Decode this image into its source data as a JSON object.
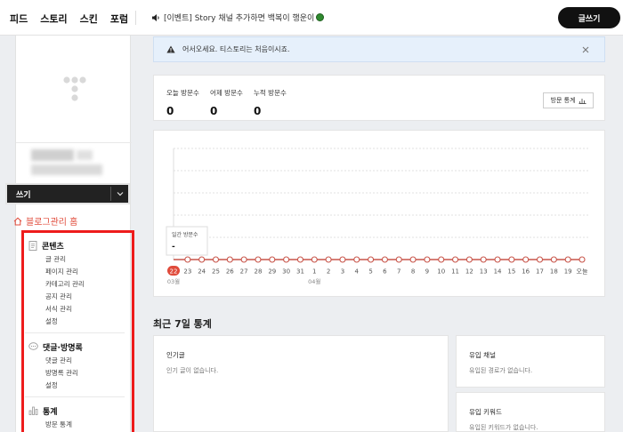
{
  "nav": [
    "피드",
    "스토리",
    "스킨",
    "포럼"
  ],
  "notice": {
    "text": "[이벤트] Story 채널 추가하면 백복이 행운이",
    "icon": "speaker-icon"
  },
  "write_button": "글쓰기",
  "sidebar": {
    "write_bar_label": "쓰기",
    "home_link": "블로그관리 홈",
    "sections": [
      {
        "title": "콘텐츠",
        "icon": "document-icon",
        "items": [
          "글 관리",
          "페이지 관리",
          "카테고리 관리",
          "공지 관리",
          "서식 관리",
          "설정"
        ]
      },
      {
        "title": "댓글·방명록",
        "icon": "speech-bubble-icon",
        "items": [
          "댓글 관리",
          "방명록 관리",
          "설정"
        ]
      },
      {
        "title": "통계",
        "icon": "bar-chart-icon",
        "items": [
          "방문 통계"
        ]
      }
    ]
  },
  "alert": {
    "text": "어서오세요. 티스토리는 처음이시죠."
  },
  "stats": {
    "today_label": "오늘 방문수",
    "today_value": "0",
    "yesterday_label": "어제 방문수",
    "yesterday_value": "0",
    "total_label": "누적 방문수",
    "total_value": "0",
    "visit_stats_button": "방문 통계"
  },
  "chart_data": {
    "type": "line",
    "x": [
      "22",
      "23",
      "24",
      "25",
      "26",
      "27",
      "28",
      "29",
      "30",
      "31",
      "1",
      "2",
      "3",
      "4",
      "5",
      "6",
      "7",
      "8",
      "9",
      "10",
      "11",
      "12",
      "13",
      "14",
      "15",
      "16",
      "17",
      "18",
      "19",
      "오늘"
    ],
    "values": [
      0,
      0,
      0,
      0,
      0,
      0,
      0,
      0,
      0,
      0,
      0,
      0,
      0,
      0,
      0,
      0,
      0,
      0,
      0,
      0,
      0,
      0,
      0,
      0,
      0,
      0,
      0,
      0,
      0,
      0
    ],
    "month_labels": [
      {
        "text": "03월",
        "at": "22"
      },
      {
        "text": "04월",
        "at": "1"
      }
    ],
    "highlighted": "22",
    "tooltip": {
      "label": "일간 방문수",
      "value": "-"
    },
    "color": "#c8554a",
    "grid": true
  },
  "recent": {
    "title": "최근 7일 통계",
    "popular_title": "인기글",
    "popular_empty": "인기 글이 없습니다.",
    "inflow_title": "유입 채널",
    "inflow_empty": "유입된 경로가 없습니다.",
    "keyword_title": "유입 키워드",
    "keyword_empty": "유입된 키워드가 없습니다."
  }
}
